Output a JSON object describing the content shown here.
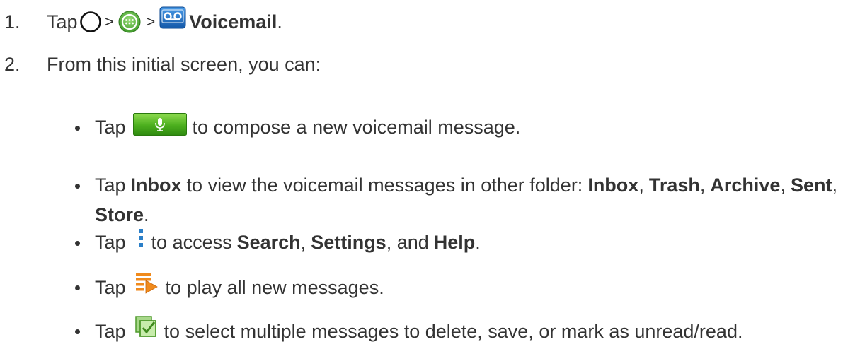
{
  "steps": [
    {
      "number": "1.",
      "tap": "Tap",
      "sep1": ">",
      "sep2": ">",
      "app_name": "Voicemail",
      "end": "."
    },
    {
      "number": "2.",
      "text": "From this initial screen, you can:"
    }
  ],
  "bullets": {
    "compose": {
      "tap": "Tap",
      "rest": "to compose a new voicemail message."
    },
    "folders": {
      "tap": "Tap",
      "inbox": "Inbox",
      "middle": "to view the voicemail messages in other folder:",
      "f1": "Inbox",
      "f2": "Trash",
      "f3": "Archive",
      "f4": "Sent",
      "f5": "Store",
      "comma": ",",
      "end": "."
    },
    "menu": {
      "tap": "Tap",
      "middle": "to access",
      "search": "Search",
      "settings": "Settings",
      "help": "Help",
      "comma": ",",
      "and": ", and",
      "end": "."
    },
    "play": {
      "tap": "Tap",
      "rest": "to play all new messages."
    },
    "select": {
      "tap": "Tap",
      "rest": "to select multiple messages to delete, save, or mark as unread/read."
    }
  },
  "icons": {
    "home": "home-circle-icon",
    "apps": "apps-launcher-icon",
    "voicemail": "voicemail-app-icon",
    "compose": "microphone-compose-icon",
    "menu": "overflow-menu-icon",
    "play_all": "play-all-icon",
    "select": "multi-select-icon"
  },
  "colors": {
    "text": "#333333",
    "voicemail_blue": "#1f6fc4",
    "compose_green": "#4caf1e",
    "play_orange": "#f08a1c",
    "select_green": "#6ab04c",
    "menu_blue": "#2b7fc8"
  }
}
